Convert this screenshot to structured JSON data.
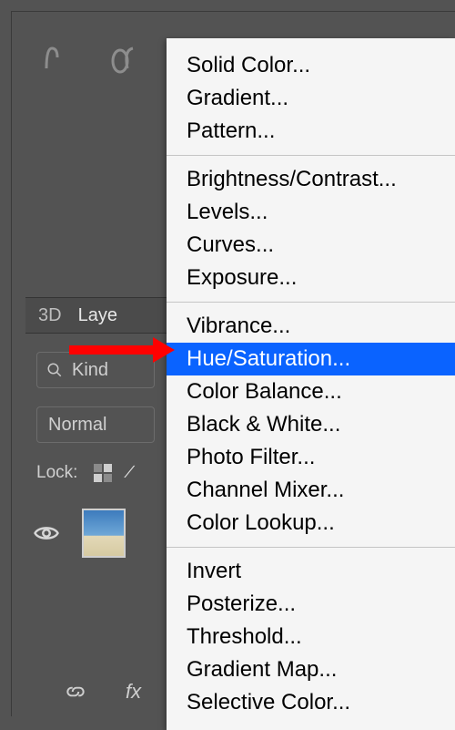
{
  "panel": {
    "tabs": {
      "threeD": "3D",
      "layers": "Laye"
    },
    "filter": {
      "label": "Kind"
    },
    "blend": {
      "label": "Normal"
    },
    "lock": {
      "label": "Lock:"
    }
  },
  "menu": {
    "group1": [
      {
        "label": "Solid Color...",
        "highlight": false
      },
      {
        "label": "Gradient...",
        "highlight": false
      },
      {
        "label": "Pattern...",
        "highlight": false
      }
    ],
    "group2": [
      {
        "label": "Brightness/Contrast...",
        "highlight": false
      },
      {
        "label": "Levels...",
        "highlight": false
      },
      {
        "label": "Curves...",
        "highlight": false
      },
      {
        "label": "Exposure...",
        "highlight": false
      }
    ],
    "group3": [
      {
        "label": "Vibrance...",
        "highlight": false
      },
      {
        "label": "Hue/Saturation...",
        "highlight": true
      },
      {
        "label": "Color Balance...",
        "highlight": false
      },
      {
        "label": "Black & White...",
        "highlight": false
      },
      {
        "label": "Photo Filter...",
        "highlight": false
      },
      {
        "label": "Channel Mixer...",
        "highlight": false
      },
      {
        "label": "Color Lookup...",
        "highlight": false
      }
    ],
    "group4": [
      {
        "label": "Invert",
        "highlight": false
      },
      {
        "label": "Posterize...",
        "highlight": false
      },
      {
        "label": "Threshold...",
        "highlight": false
      },
      {
        "label": "Gradient Map...",
        "highlight": false
      },
      {
        "label": "Selective Color...",
        "highlight": false
      }
    ]
  },
  "annotation": {
    "arrow_color": "#ff0000"
  }
}
